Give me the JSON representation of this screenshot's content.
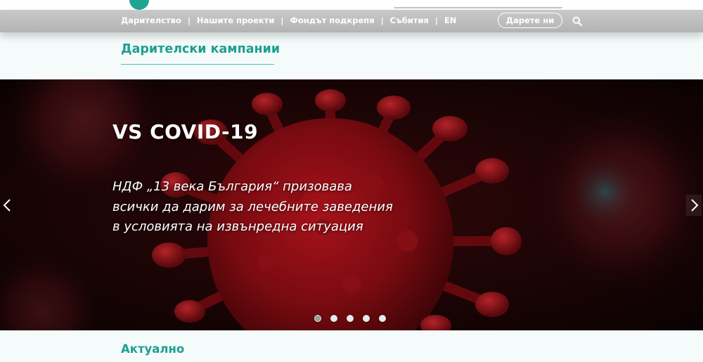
{
  "nav": {
    "items": [
      {
        "label": "Дарителство"
      },
      {
        "label": "Нашите проекти"
      },
      {
        "label": "Фондът подкрепя"
      },
      {
        "label": "Събития"
      },
      {
        "label": "EN"
      }
    ],
    "separator": "|",
    "donate_label": "Дарете ни",
    "search_icon": "search-icon"
  },
  "section": {
    "campaigns_title": "Дарителски кампании",
    "news_title": "Актуално"
  },
  "hero": {
    "title": "VS COVID-19",
    "lines": [
      "НДФ „13 века България“ призовава",
      "всички да дарим за лечебните заведения",
      "в условията на извънредна ситуация"
    ],
    "slides_count": 5,
    "active_slide": 1
  },
  "colors": {
    "accent": "#1e9f90",
    "navbar": "#b3b3b3",
    "hero_dark": "#1a0506",
    "virus_red": "#b3121a"
  }
}
